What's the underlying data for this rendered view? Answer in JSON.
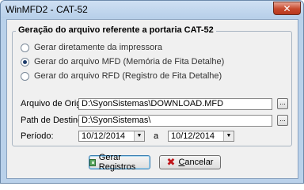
{
  "window": {
    "title": "WinMFD2 - CAT-52",
    "close_glyph": "✕"
  },
  "group": {
    "title": "Geração do arquivo referente a portaria CAT-52"
  },
  "options": [
    {
      "label": "Gerar diretamente da impressora",
      "checked": false
    },
    {
      "label": "Gerar do arquivo MFD (Memória de Fita Detalhe)",
      "checked": true
    },
    {
      "label": "Gerar do arquivo RFD (Registro de Fita Detalhe)",
      "checked": false
    }
  ],
  "fields": {
    "origin_label": "Arquivo de Origem:",
    "origin_value": "D:\\SyonSistemas\\DOWNLOAD.MFD",
    "dest_label": "Path de Destino:",
    "dest_value": "D:\\SyonSistemas\\",
    "browse_label": "...",
    "period_label": "Período:",
    "date_from": "10/12/2014",
    "date_to": "10/12/2014",
    "separator": "a"
  },
  "buttons": {
    "generate_label": "Gerar Registros",
    "cancel_first": "C",
    "cancel_rest": "ancelar"
  },
  "icons": {
    "generate": "grid-icon",
    "cancel": "close-icon",
    "dropdown": "chevron-down-icon"
  }
}
